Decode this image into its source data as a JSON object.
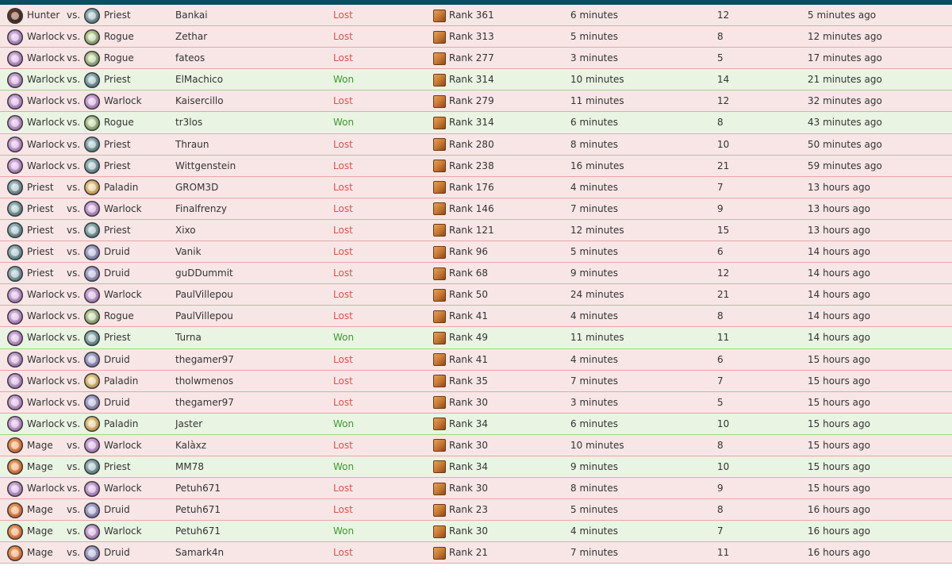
{
  "colors": {
    "top_bar": "#0f4a66",
    "lost_text": "#d9534f",
    "won_text": "#3c9a2e",
    "lost_row": "#f8e6e6",
    "won_row": "#eaf4e3"
  },
  "rank_icon": "rank-cube-icon",
  "rows": [
    {
      "pclass": "Hunter",
      "picon": "hunter-icon",
      "vs": "vs.",
      "oclass": "Priest",
      "oicon": "priest-icon",
      "opponent": "Bankai",
      "result": "Lost",
      "rank": "Rank 361",
      "duration": "6 minutes",
      "turns": "12",
      "ago": "5 minutes ago"
    },
    {
      "pclass": "Warlock",
      "picon": "warlock-icon",
      "vs": "vs.",
      "oclass": "Rogue",
      "oicon": "rogue-icon",
      "opponent": "Zethar",
      "result": "Lost",
      "rank": "Rank 313",
      "duration": "5 minutes",
      "turns": "8",
      "ago": "12 minutes ago"
    },
    {
      "pclass": "Warlock",
      "picon": "warlock-icon",
      "vs": "vs.",
      "oclass": "Rogue",
      "oicon": "rogue-icon",
      "opponent": "fateos",
      "result": "Lost",
      "rank": "Rank 277",
      "duration": "3 minutes",
      "turns": "5",
      "ago": "17 minutes ago"
    },
    {
      "pclass": "Warlock",
      "picon": "warlock-icon",
      "vs": "vs.",
      "oclass": "Priest",
      "oicon": "priest-icon",
      "opponent": "ElMachico",
      "result": "Won",
      "rank": "Rank 314",
      "duration": "10 minutes",
      "turns": "14",
      "ago": "21 minutes ago"
    },
    {
      "pclass": "Warlock",
      "picon": "warlock-icon",
      "vs": "vs.",
      "oclass": "Warlock",
      "oicon": "warlock-icon",
      "opponent": "Kaisercillo",
      "result": "Lost",
      "rank": "Rank 279",
      "duration": "11 minutes",
      "turns": "12",
      "ago": "32 minutes ago"
    },
    {
      "pclass": "Warlock",
      "picon": "warlock-icon",
      "vs": "vs.",
      "oclass": "Rogue",
      "oicon": "rogue-icon",
      "opponent": "tr3los",
      "result": "Won",
      "rank": "Rank 314",
      "duration": "6 minutes",
      "turns": "8",
      "ago": "43 minutes ago"
    },
    {
      "pclass": "Warlock",
      "picon": "warlock-icon",
      "vs": "vs.",
      "oclass": "Priest",
      "oicon": "priest-icon",
      "opponent": "Thraun",
      "result": "Lost",
      "rank": "Rank 280",
      "duration": "8 minutes",
      "turns": "10",
      "ago": "50 minutes ago"
    },
    {
      "pclass": "Warlock",
      "picon": "warlock-icon",
      "vs": "vs.",
      "oclass": "Priest",
      "oicon": "priest-icon",
      "opponent": "Wittgenstein",
      "result": "Lost",
      "rank": "Rank 238",
      "duration": "16 minutes",
      "turns": "21",
      "ago": "59 minutes ago"
    },
    {
      "pclass": "Priest",
      "picon": "priest-icon",
      "vs": "vs.",
      "oclass": "Paladin",
      "oicon": "paladin-icon",
      "opponent": "GROM3D",
      "result": "Lost",
      "rank": "Rank 176",
      "duration": "4 minutes",
      "turns": "7",
      "ago": "13 hours ago"
    },
    {
      "pclass": "Priest",
      "picon": "priest-icon",
      "vs": "vs.",
      "oclass": "Warlock",
      "oicon": "warlock-icon",
      "opponent": "Finalfrenzy",
      "result": "Lost",
      "rank": "Rank 146",
      "duration": "7 minutes",
      "turns": "9",
      "ago": "13 hours ago"
    },
    {
      "pclass": "Priest",
      "picon": "priest-icon",
      "vs": "vs.",
      "oclass": "Priest",
      "oicon": "priest-icon",
      "opponent": "Xixo",
      "result": "Lost",
      "rank": "Rank 121",
      "duration": "12 minutes",
      "turns": "15",
      "ago": "13 hours ago"
    },
    {
      "pclass": "Priest",
      "picon": "priest-icon",
      "vs": "vs.",
      "oclass": "Druid",
      "oicon": "druid-icon",
      "opponent": "Vanik",
      "result": "Lost",
      "rank": "Rank 96",
      "duration": "5 minutes",
      "turns": "6",
      "ago": "14 hours ago"
    },
    {
      "pclass": "Priest",
      "picon": "priest-icon",
      "vs": "vs.",
      "oclass": "Druid",
      "oicon": "druid-icon",
      "opponent": "guDDummit",
      "result": "Lost",
      "rank": "Rank 68",
      "duration": "9 minutes",
      "turns": "12",
      "ago": "14 hours ago"
    },
    {
      "pclass": "Warlock",
      "picon": "warlock-icon",
      "vs": "vs.",
      "oclass": "Warlock",
      "oicon": "warlock-icon",
      "opponent": "PaulVillepou",
      "result": "Lost",
      "rank": "Rank 50",
      "duration": "24 minutes",
      "turns": "21",
      "ago": "14 hours ago"
    },
    {
      "pclass": "Warlock",
      "picon": "warlock-icon",
      "vs": "vs.",
      "oclass": "Rogue",
      "oicon": "rogue-icon",
      "opponent": "PaulVillepou",
      "result": "Lost",
      "rank": "Rank 41",
      "duration": "4 minutes",
      "turns": "8",
      "ago": "14 hours ago"
    },
    {
      "pclass": "Warlock",
      "picon": "warlock-icon",
      "vs": "vs.",
      "oclass": "Priest",
      "oicon": "priest-icon",
      "opponent": "Turna",
      "result": "Won",
      "rank": "Rank 49",
      "duration": "11 minutes",
      "turns": "11",
      "ago": "14 hours ago"
    },
    {
      "pclass": "Warlock",
      "picon": "warlock-icon",
      "vs": "vs.",
      "oclass": "Druid",
      "oicon": "druid-icon",
      "opponent": "thegamer97",
      "result": "Lost",
      "rank": "Rank 41",
      "duration": "4 minutes",
      "turns": "6",
      "ago": "15 hours ago"
    },
    {
      "pclass": "Warlock",
      "picon": "warlock-icon",
      "vs": "vs.",
      "oclass": "Paladin",
      "oicon": "paladin-icon",
      "opponent": "tholwmenos",
      "result": "Lost",
      "rank": "Rank 35",
      "duration": "7 minutes",
      "turns": "7",
      "ago": "15 hours ago"
    },
    {
      "pclass": "Warlock",
      "picon": "warlock-icon",
      "vs": "vs.",
      "oclass": "Druid",
      "oicon": "druid-icon",
      "opponent": "thegamer97",
      "result": "Lost",
      "rank": "Rank 30",
      "duration": "3 minutes",
      "turns": "5",
      "ago": "15 hours ago"
    },
    {
      "pclass": "Warlock",
      "picon": "warlock-icon",
      "vs": "vs.",
      "oclass": "Paladin",
      "oicon": "paladin-icon",
      "opponent": "Jaster",
      "result": "Won",
      "rank": "Rank 34",
      "duration": "6 minutes",
      "turns": "10",
      "ago": "15 hours ago"
    },
    {
      "pclass": "Mage",
      "picon": "mage-icon",
      "vs": "vs.",
      "oclass": "Warlock",
      "oicon": "warlock-icon",
      "opponent": "Kalàxz",
      "result": "Lost",
      "rank": "Rank 30",
      "duration": "10 minutes",
      "turns": "8",
      "ago": "15 hours ago"
    },
    {
      "pclass": "Mage",
      "picon": "mage-icon",
      "vs": "vs.",
      "oclass": "Priest",
      "oicon": "priest-icon",
      "opponent": "MM78",
      "result": "Won",
      "rank": "Rank 34",
      "duration": "9 minutes",
      "turns": "10",
      "ago": "15 hours ago"
    },
    {
      "pclass": "Warlock",
      "picon": "warlock-icon",
      "vs": "vs.",
      "oclass": "Warlock",
      "oicon": "warlock-icon",
      "opponent": "Petuh671",
      "result": "Lost",
      "rank": "Rank 30",
      "duration": "8 minutes",
      "turns": "9",
      "ago": "15 hours ago"
    },
    {
      "pclass": "Mage",
      "picon": "mage-icon",
      "vs": "vs.",
      "oclass": "Druid",
      "oicon": "druid-icon",
      "opponent": "Petuh671",
      "result": "Lost",
      "rank": "Rank 23",
      "duration": "5 minutes",
      "turns": "8",
      "ago": "16 hours ago"
    },
    {
      "pclass": "Mage",
      "picon": "mage-icon",
      "vs": "vs.",
      "oclass": "Warlock",
      "oicon": "warlock-icon",
      "opponent": "Petuh671",
      "result": "Won",
      "rank": "Rank 30",
      "duration": "4 minutes",
      "turns": "7",
      "ago": "16 hours ago"
    },
    {
      "pclass": "Mage",
      "picon": "mage-icon",
      "vs": "vs.",
      "oclass": "Druid",
      "oicon": "druid-icon",
      "opponent": "Samark4n",
      "result": "Lost",
      "rank": "Rank 21",
      "duration": "7 minutes",
      "turns": "11",
      "ago": "16 hours ago"
    }
  ]
}
